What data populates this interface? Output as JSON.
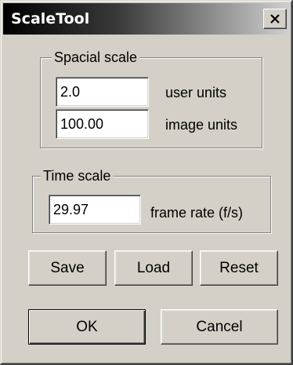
{
  "window": {
    "title": "ScaleTool"
  },
  "spacial_scale": {
    "label": "Spacial scale",
    "user_units_value": "2.0",
    "user_units_label": "user units",
    "image_units_value": "100.00",
    "image_units_label": "image units"
  },
  "time_scale": {
    "label": "Time scale",
    "frame_rate_value": "29.97",
    "frame_rate_label": "frame rate (f/s)"
  },
  "buttons": {
    "save": "Save",
    "load": "Load",
    "reset": "Reset",
    "ok": "OK",
    "cancel": "Cancel"
  },
  "icons": {
    "close": "close-icon"
  },
  "colors": {
    "dialog_face": "#d4d0c8",
    "titlebar_start": "#000000",
    "titlebar_end": "#d0d0d0"
  }
}
